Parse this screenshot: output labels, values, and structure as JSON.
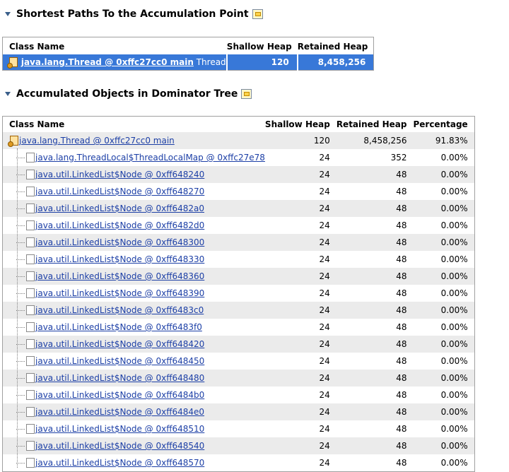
{
  "section1": {
    "title": "Shortest Paths To the Accumulation Point",
    "columns": {
      "class_name": "Class Name",
      "shallow": "Shallow Heap",
      "retained": "Retained Heap"
    },
    "row": {
      "object": "java.lang.Thread @ 0xffc27cc0 main",
      "suffix": "Thread",
      "shallow": "120",
      "retained": "8,458,256"
    }
  },
  "section2": {
    "title": "Accumulated Objects in Dominator Tree",
    "columns": {
      "class_name": "Class Name",
      "shallow": "Shallow Heap",
      "retained": "Retained Heap",
      "percentage": "Percentage"
    },
    "rows": [
      {
        "name": "java.lang.Thread @ 0xffc27cc0 main",
        "shallow": "120",
        "retained": "8,458,256",
        "percentage": "91.83%",
        "level": 0
      },
      {
        "name": "java.lang.ThreadLocal$ThreadLocalMap @ 0xffc27e78",
        "shallow": "24",
        "retained": "352",
        "percentage": "0.00%",
        "level": 1
      },
      {
        "name": "java.util.LinkedList$Node @ 0xff648240",
        "shallow": "24",
        "retained": "48",
        "percentage": "0.00%",
        "level": 1
      },
      {
        "name": "java.util.LinkedList$Node @ 0xff648270",
        "shallow": "24",
        "retained": "48",
        "percentage": "0.00%",
        "level": 1
      },
      {
        "name": "java.util.LinkedList$Node @ 0xff6482a0",
        "shallow": "24",
        "retained": "48",
        "percentage": "0.00%",
        "level": 1
      },
      {
        "name": "java.util.LinkedList$Node @ 0xff6482d0",
        "shallow": "24",
        "retained": "48",
        "percentage": "0.00%",
        "level": 1
      },
      {
        "name": "java.util.LinkedList$Node @ 0xff648300",
        "shallow": "24",
        "retained": "48",
        "percentage": "0.00%",
        "level": 1
      },
      {
        "name": "java.util.LinkedList$Node @ 0xff648330",
        "shallow": "24",
        "retained": "48",
        "percentage": "0.00%",
        "level": 1
      },
      {
        "name": "java.util.LinkedList$Node @ 0xff648360",
        "shallow": "24",
        "retained": "48",
        "percentage": "0.00%",
        "level": 1
      },
      {
        "name": "java.util.LinkedList$Node @ 0xff648390",
        "shallow": "24",
        "retained": "48",
        "percentage": "0.00%",
        "level": 1
      },
      {
        "name": "java.util.LinkedList$Node @ 0xff6483c0",
        "shallow": "24",
        "retained": "48",
        "percentage": "0.00%",
        "level": 1
      },
      {
        "name": "java.util.LinkedList$Node @ 0xff6483f0",
        "shallow": "24",
        "retained": "48",
        "percentage": "0.00%",
        "level": 1
      },
      {
        "name": "java.util.LinkedList$Node @ 0xff648420",
        "shallow": "24",
        "retained": "48",
        "percentage": "0.00%",
        "level": 1
      },
      {
        "name": "java.util.LinkedList$Node @ 0xff648450",
        "shallow": "24",
        "retained": "48",
        "percentage": "0.00%",
        "level": 1
      },
      {
        "name": "java.util.LinkedList$Node @ 0xff648480",
        "shallow": "24",
        "retained": "48",
        "percentage": "0.00%",
        "level": 1
      },
      {
        "name": "java.util.LinkedList$Node @ 0xff6484b0",
        "shallow": "24",
        "retained": "48",
        "percentage": "0.00%",
        "level": 1
      },
      {
        "name": "java.util.LinkedList$Node @ 0xff6484e0",
        "shallow": "24",
        "retained": "48",
        "percentage": "0.00%",
        "level": 1
      },
      {
        "name": "java.util.LinkedList$Node @ 0xff648510",
        "shallow": "24",
        "retained": "48",
        "percentage": "0.00%",
        "level": 1
      },
      {
        "name": "java.util.LinkedList$Node @ 0xff648540",
        "shallow": "24",
        "retained": "48",
        "percentage": "0.00%",
        "level": 1
      },
      {
        "name": "java.util.LinkedList$Node @ 0xff648570",
        "shallow": "24",
        "retained": "48",
        "percentage": "0.00%",
        "level": 1
      }
    ]
  },
  "icons": {
    "collapse": "collapse-triangle-icon",
    "section_action": "copy-to-clipboard-icon",
    "thread": "thread-object-icon",
    "object": "object-instance-icon"
  },
  "colors": {
    "selection": "#3878d8",
    "link": "#1c3fa6",
    "alt_row": "#ebebeb",
    "title_triangle": "#3a5f8a"
  }
}
